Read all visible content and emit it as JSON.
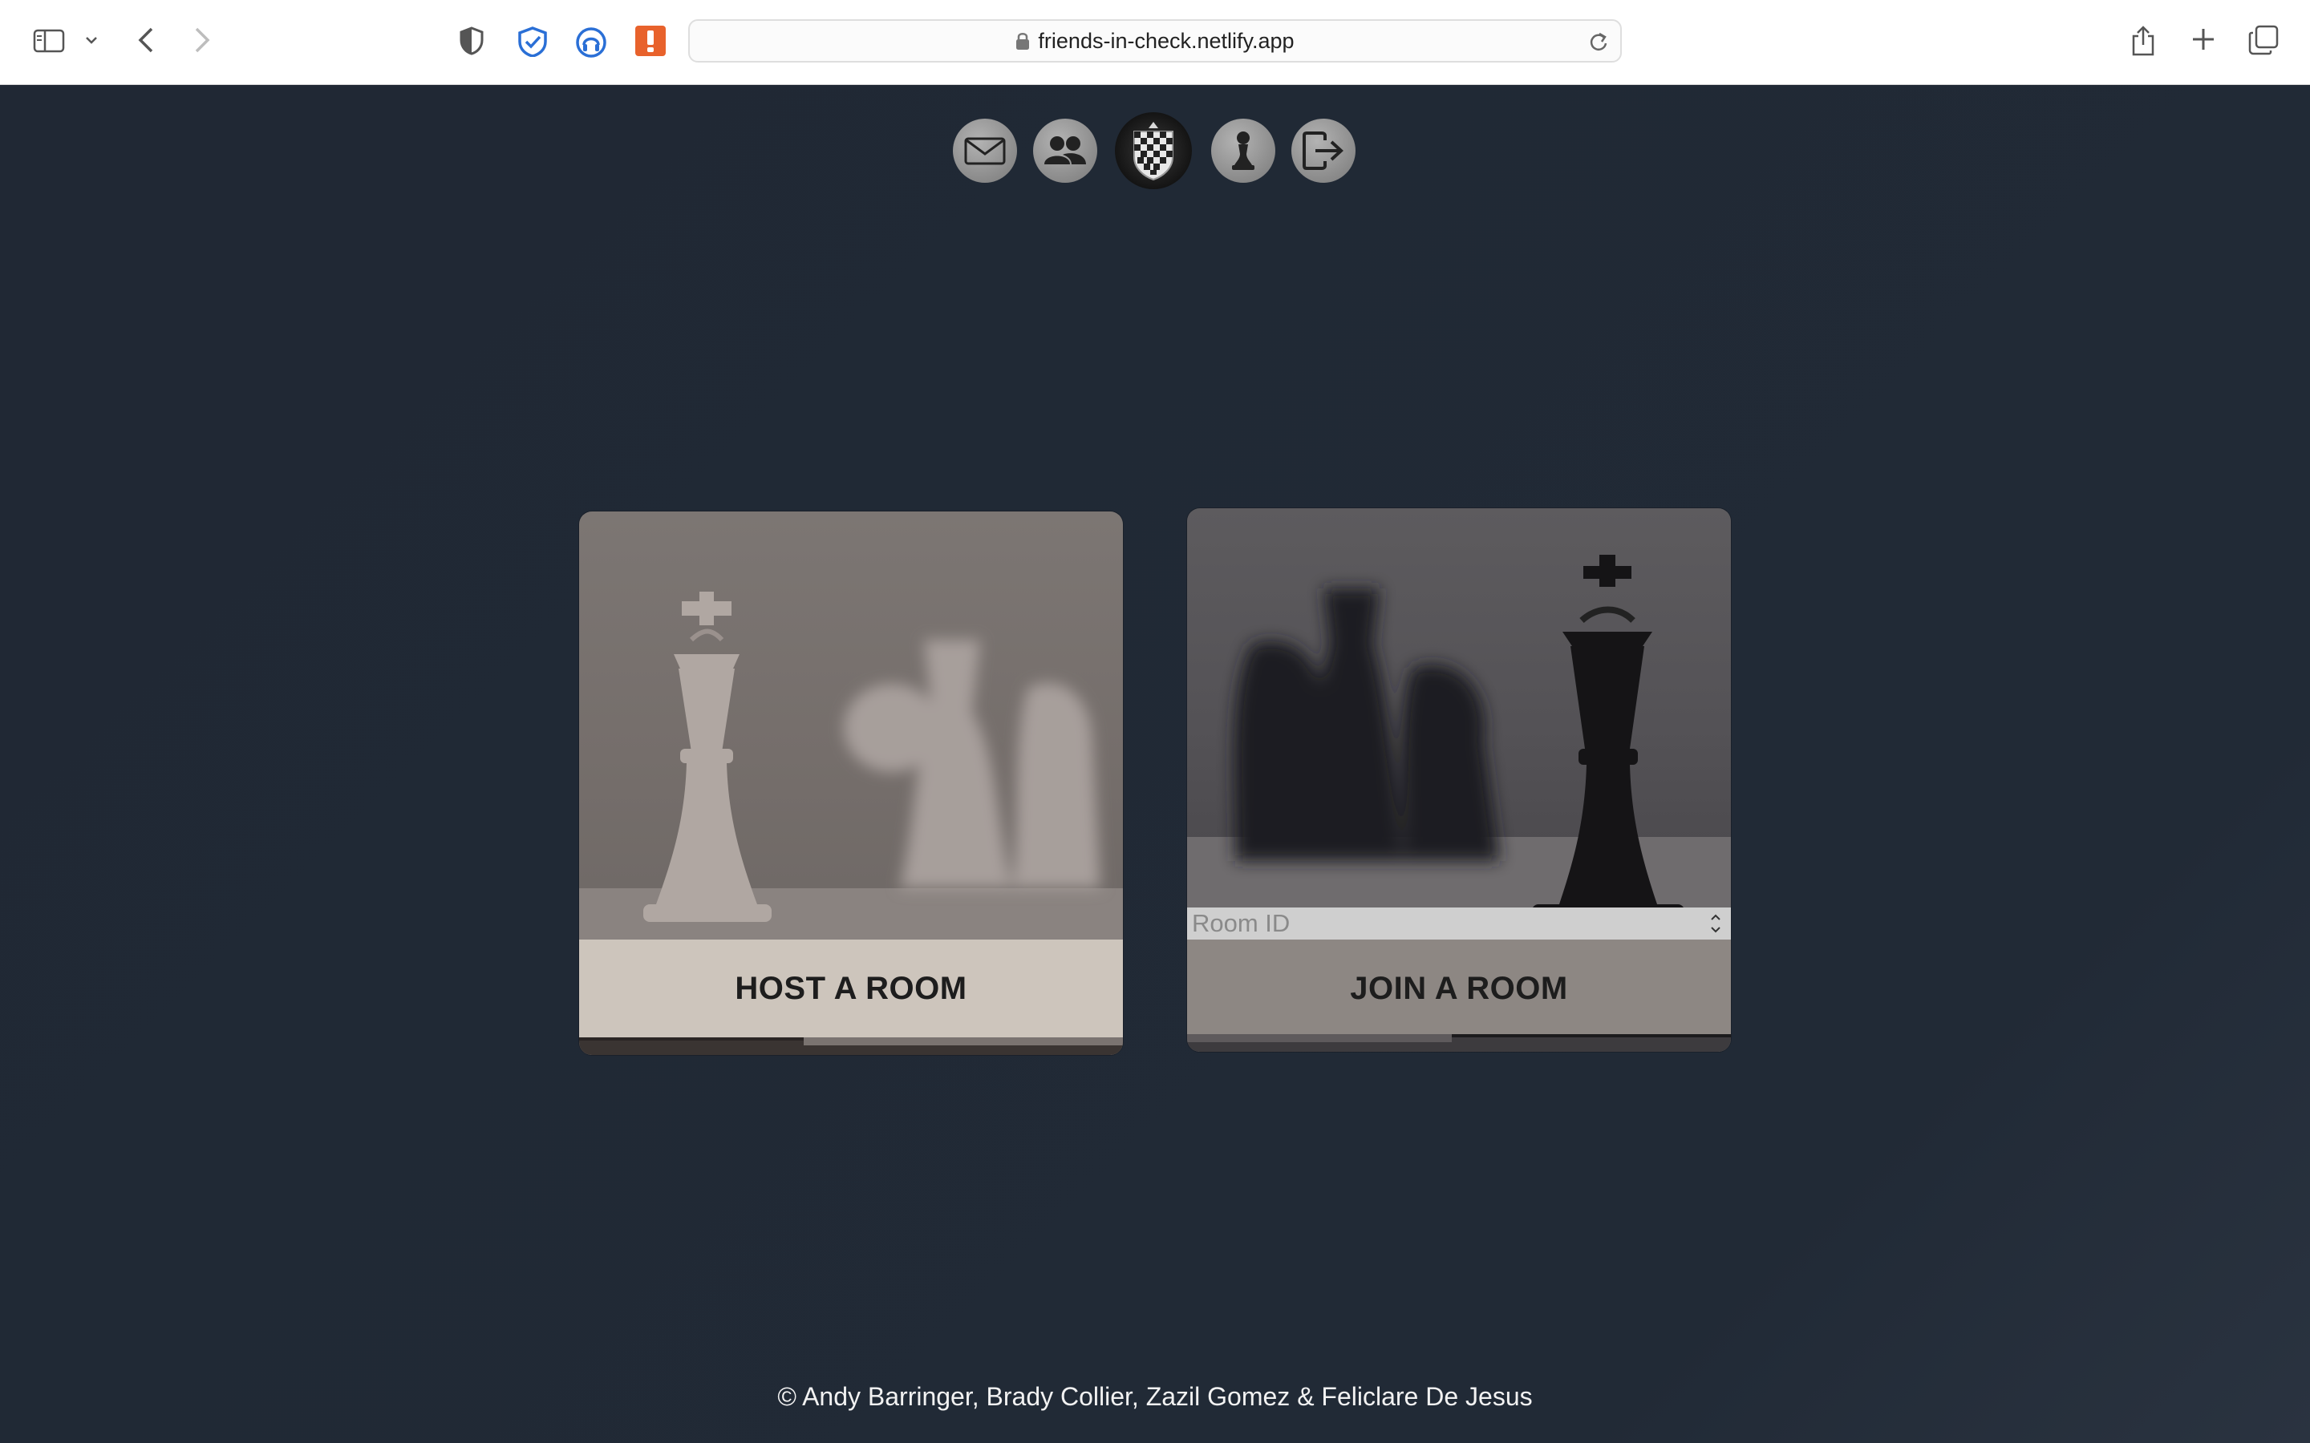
{
  "browser": {
    "url": "friends-in-check.netlify.app"
  },
  "nav": {
    "items": [
      {
        "name": "mail-icon"
      },
      {
        "name": "friends-icon"
      },
      {
        "name": "chess-logo"
      },
      {
        "name": "pawn-icon"
      },
      {
        "name": "logout-icon"
      }
    ]
  },
  "host_card": {
    "label": "HOST A ROOM"
  },
  "join_card": {
    "label": "JOIN A ROOM",
    "room_id_placeholder": "Room ID"
  },
  "footer": {
    "credits": "© Andy Barringer, Brady Collier, Zazil Gomez & Feliclare De Jesus"
  },
  "colors": {
    "page_background": "#212935",
    "accent_orange": "#e8622c",
    "accent_blue": "#2a6fd6"
  }
}
